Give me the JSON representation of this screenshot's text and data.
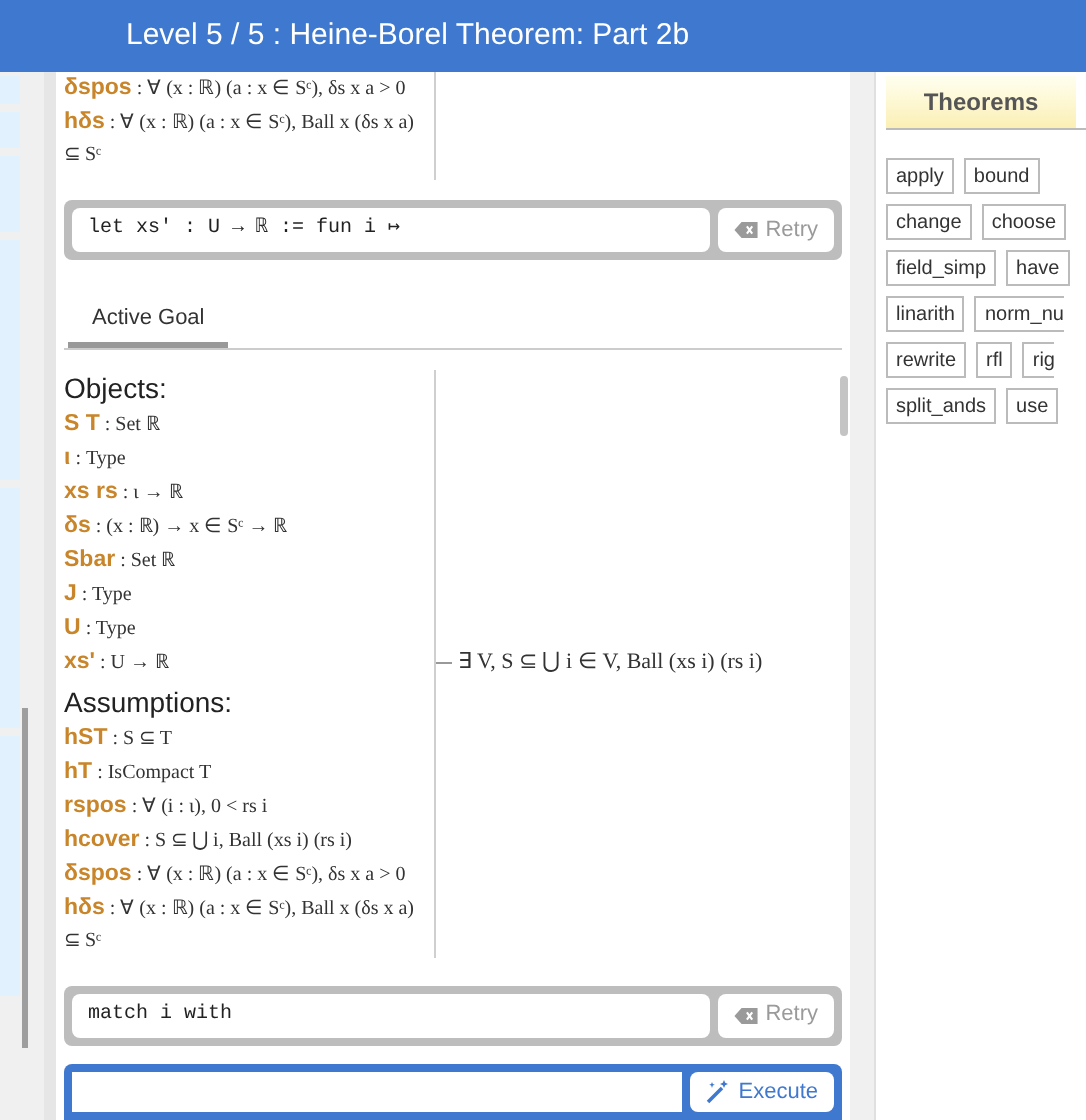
{
  "header": {
    "title": "Level 5 / 5 : Heine-Borel Theorem: Part 2b"
  },
  "previous_hypotheses": [
    {
      "names": "δspos",
      "type": ": ∀ (x : ℝ) (a : x ∈ Sᶜ), δs x a > 0"
    },
    {
      "names": "hδs",
      "type": ": ∀ (x : ℝ) (a : x ∈ Sᶜ), Ball x (δs x a) ⊆ Sᶜ"
    }
  ],
  "command_1": {
    "code": "let xs' : U → ℝ := fun i ↦",
    "button": "Retry",
    "disabled": true
  },
  "goal_tabs": [
    {
      "label": "Active Goal",
      "selected": true
    }
  ],
  "goal": {
    "objects_heading": "Objects:",
    "objects": [
      {
        "names": "S T",
        "type": ": Set ℝ"
      },
      {
        "names": "ι",
        "type": ": Type"
      },
      {
        "names": "xs rs",
        "type": ": ι → ℝ"
      },
      {
        "names": "δs",
        "type": ": (x : ℝ) → x ∈ Sᶜ → ℝ"
      },
      {
        "names": "Sbar",
        "type": ": Set ℝ"
      },
      {
        "names": "J",
        "type": ": Type"
      },
      {
        "names": "U",
        "type": ": Type"
      },
      {
        "names": "xs'",
        "type": ": U → ℝ"
      }
    ],
    "assumptions_heading": "Assumptions:",
    "assumptions": [
      {
        "names": "hST",
        "type": ": S ⊆ T"
      },
      {
        "names": "hT",
        "type": ": IsCompact T"
      },
      {
        "names": "rspos",
        "type": ": ∀ (i : ι), 0 < rs i"
      },
      {
        "names": "hcover",
        "type": ": S ⊆ ⋃ i, Ball (xs i) (rs i)"
      },
      {
        "names": "δspos",
        "type": ": ∀ (x : ℝ) (a : x ∈ Sᶜ), δs x a > 0"
      },
      {
        "names": "hδs",
        "type": ": ∀ (x : ℝ) (a : x ∈ Sᶜ), Ball x (δs x a) ⊆ Sᶜ"
      }
    ],
    "target": "∃ V, S ⊆ ⋃ i ∈ V, Ball (xs i) (rs i)"
  },
  "command_2": {
    "code": "match i with",
    "button": "Retry",
    "disabled": true
  },
  "input": {
    "button": "Execute"
  },
  "sidebar": {
    "tabs": [
      {
        "label": "Theorems",
        "selected": true
      }
    ],
    "tactic_rows": [
      [
        "apply",
        "bound"
      ],
      [
        "change",
        "choose"
      ],
      [
        "field_simp",
        "have"
      ],
      [
        "linarith",
        "norm_nu"
      ],
      [
        "rewrite",
        "rfl",
        "rig"
      ],
      [
        "split_ands",
        "use"
      ]
    ]
  }
}
